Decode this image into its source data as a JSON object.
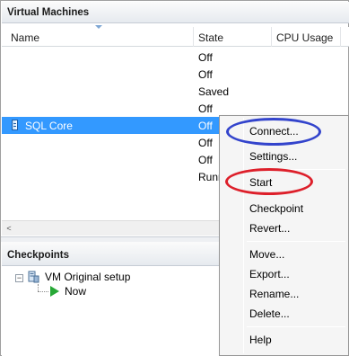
{
  "vm_pane": {
    "title": "Virtual Machines",
    "columns": {
      "name": "Name",
      "state": "State",
      "cpu": "CPU Usage"
    },
    "rows": [
      {
        "name": "",
        "state": "Off"
      },
      {
        "name": "",
        "state": "Off"
      },
      {
        "name": "",
        "state": "Saved"
      },
      {
        "name": "",
        "state": "Off"
      },
      {
        "name": "SQL Core",
        "state": "Off"
      },
      {
        "name": "",
        "state": "Off"
      },
      {
        "name": "",
        "state": "Off"
      },
      {
        "name": "",
        "state": "Runn"
      }
    ],
    "scroll_left": "<"
  },
  "checkpoints_pane": {
    "title": "Checkpoints",
    "expander": "−",
    "root": "VM Original setup",
    "child": "Now"
  },
  "context_menu": {
    "items": [
      {
        "label": "Connect...",
        "group": 1
      },
      {
        "label": "Settings...",
        "group": 1
      },
      {
        "label": "Start",
        "group": 2
      },
      {
        "label": "Checkpoint",
        "group": 2
      },
      {
        "label": "Revert...",
        "group": 2
      },
      {
        "label": "Move...",
        "group": 3
      },
      {
        "label": "Export...",
        "group": 3
      },
      {
        "label": "Rename...",
        "group": 3
      },
      {
        "label": "Delete...",
        "group": 3
      },
      {
        "label": "Help",
        "group": 4
      }
    ]
  },
  "annotations": {
    "connect_circle_color": "#3344cc",
    "start_circle_color": "#dd1f2a"
  },
  "colors": {
    "selection": "#3399ff",
    "checkpoint_play": "#27a836"
  }
}
